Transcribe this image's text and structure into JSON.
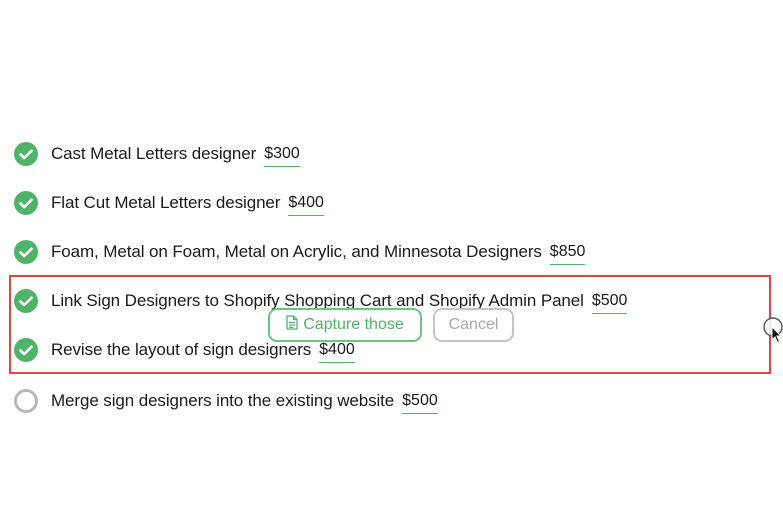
{
  "tasks": [
    {
      "label": "Cast Metal Letters designer",
      "price": "$300",
      "done": true
    },
    {
      "label": "Flat Cut Metal Letters designer",
      "price": "$400",
      "done": true
    },
    {
      "label": "Foam, Metal on Foam, Metal on Acrylic, and Minnesota Designers",
      "price": "$850",
      "done": true
    },
    {
      "label": "Link Sign Designers to Shopify Shopping Cart and Shopify Admin Panel",
      "price": "$500",
      "done": true
    },
    {
      "label": "Revise the layout of sign designers",
      "price": "$400",
      "done": true
    },
    {
      "label": "Merge sign designers into the existing website",
      "price": "$500",
      "done": false
    }
  ],
  "selection": {
    "capture_label": "Capture those",
    "cancel_label": "Cancel"
  },
  "colors": {
    "accent_green": "#4fb36a",
    "selection_red": "#e0473a",
    "muted_gray": "#b7b7b7"
  },
  "icons": {
    "done": "check-circle-icon",
    "pending": "empty-circle-icon",
    "capture": "document-icon",
    "cursor": "pointer-cursor-icon"
  }
}
